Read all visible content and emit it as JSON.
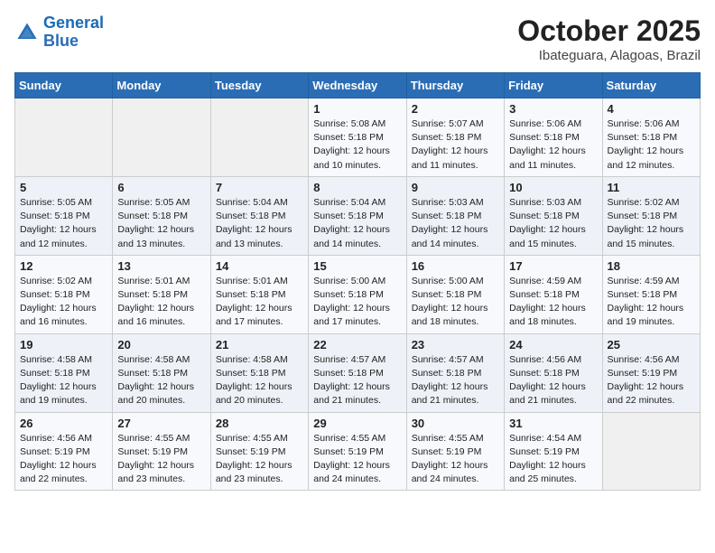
{
  "logo": {
    "text_general": "General",
    "text_blue": "Blue"
  },
  "title": {
    "month_year": "October 2025",
    "location": "Ibateguara, Alagoas, Brazil"
  },
  "headers": [
    "Sunday",
    "Monday",
    "Tuesday",
    "Wednesday",
    "Thursday",
    "Friday",
    "Saturday"
  ],
  "weeks": [
    [
      {
        "day": "",
        "info": ""
      },
      {
        "day": "",
        "info": ""
      },
      {
        "day": "",
        "info": ""
      },
      {
        "day": "1",
        "info": "Sunrise: 5:08 AM\nSunset: 5:18 PM\nDaylight: 12 hours\nand 10 minutes."
      },
      {
        "day": "2",
        "info": "Sunrise: 5:07 AM\nSunset: 5:18 PM\nDaylight: 12 hours\nand 11 minutes."
      },
      {
        "day": "3",
        "info": "Sunrise: 5:06 AM\nSunset: 5:18 PM\nDaylight: 12 hours\nand 11 minutes."
      },
      {
        "day": "4",
        "info": "Sunrise: 5:06 AM\nSunset: 5:18 PM\nDaylight: 12 hours\nand 12 minutes."
      }
    ],
    [
      {
        "day": "5",
        "info": "Sunrise: 5:05 AM\nSunset: 5:18 PM\nDaylight: 12 hours\nand 12 minutes."
      },
      {
        "day": "6",
        "info": "Sunrise: 5:05 AM\nSunset: 5:18 PM\nDaylight: 12 hours\nand 13 minutes."
      },
      {
        "day": "7",
        "info": "Sunrise: 5:04 AM\nSunset: 5:18 PM\nDaylight: 12 hours\nand 13 minutes."
      },
      {
        "day": "8",
        "info": "Sunrise: 5:04 AM\nSunset: 5:18 PM\nDaylight: 12 hours\nand 14 minutes."
      },
      {
        "day": "9",
        "info": "Sunrise: 5:03 AM\nSunset: 5:18 PM\nDaylight: 12 hours\nand 14 minutes."
      },
      {
        "day": "10",
        "info": "Sunrise: 5:03 AM\nSunset: 5:18 PM\nDaylight: 12 hours\nand 15 minutes."
      },
      {
        "day": "11",
        "info": "Sunrise: 5:02 AM\nSunset: 5:18 PM\nDaylight: 12 hours\nand 15 minutes."
      }
    ],
    [
      {
        "day": "12",
        "info": "Sunrise: 5:02 AM\nSunset: 5:18 PM\nDaylight: 12 hours\nand 16 minutes."
      },
      {
        "day": "13",
        "info": "Sunrise: 5:01 AM\nSunset: 5:18 PM\nDaylight: 12 hours\nand 16 minutes."
      },
      {
        "day": "14",
        "info": "Sunrise: 5:01 AM\nSunset: 5:18 PM\nDaylight: 12 hours\nand 17 minutes."
      },
      {
        "day": "15",
        "info": "Sunrise: 5:00 AM\nSunset: 5:18 PM\nDaylight: 12 hours\nand 17 minutes."
      },
      {
        "day": "16",
        "info": "Sunrise: 5:00 AM\nSunset: 5:18 PM\nDaylight: 12 hours\nand 18 minutes."
      },
      {
        "day": "17",
        "info": "Sunrise: 4:59 AM\nSunset: 5:18 PM\nDaylight: 12 hours\nand 18 minutes."
      },
      {
        "day": "18",
        "info": "Sunrise: 4:59 AM\nSunset: 5:18 PM\nDaylight: 12 hours\nand 19 minutes."
      }
    ],
    [
      {
        "day": "19",
        "info": "Sunrise: 4:58 AM\nSunset: 5:18 PM\nDaylight: 12 hours\nand 19 minutes."
      },
      {
        "day": "20",
        "info": "Sunrise: 4:58 AM\nSunset: 5:18 PM\nDaylight: 12 hours\nand 20 minutes."
      },
      {
        "day": "21",
        "info": "Sunrise: 4:58 AM\nSunset: 5:18 PM\nDaylight: 12 hours\nand 20 minutes."
      },
      {
        "day": "22",
        "info": "Sunrise: 4:57 AM\nSunset: 5:18 PM\nDaylight: 12 hours\nand 21 minutes."
      },
      {
        "day": "23",
        "info": "Sunrise: 4:57 AM\nSunset: 5:18 PM\nDaylight: 12 hours\nand 21 minutes."
      },
      {
        "day": "24",
        "info": "Sunrise: 4:56 AM\nSunset: 5:18 PM\nDaylight: 12 hours\nand 21 minutes."
      },
      {
        "day": "25",
        "info": "Sunrise: 4:56 AM\nSunset: 5:19 PM\nDaylight: 12 hours\nand 22 minutes."
      }
    ],
    [
      {
        "day": "26",
        "info": "Sunrise: 4:56 AM\nSunset: 5:19 PM\nDaylight: 12 hours\nand 22 minutes."
      },
      {
        "day": "27",
        "info": "Sunrise: 4:55 AM\nSunset: 5:19 PM\nDaylight: 12 hours\nand 23 minutes."
      },
      {
        "day": "28",
        "info": "Sunrise: 4:55 AM\nSunset: 5:19 PM\nDaylight: 12 hours\nand 23 minutes."
      },
      {
        "day": "29",
        "info": "Sunrise: 4:55 AM\nSunset: 5:19 PM\nDaylight: 12 hours\nand 24 minutes."
      },
      {
        "day": "30",
        "info": "Sunrise: 4:55 AM\nSunset: 5:19 PM\nDaylight: 12 hours\nand 24 minutes."
      },
      {
        "day": "31",
        "info": "Sunrise: 4:54 AM\nSunset: 5:19 PM\nDaylight: 12 hours\nand 25 minutes."
      },
      {
        "day": "",
        "info": ""
      }
    ]
  ]
}
